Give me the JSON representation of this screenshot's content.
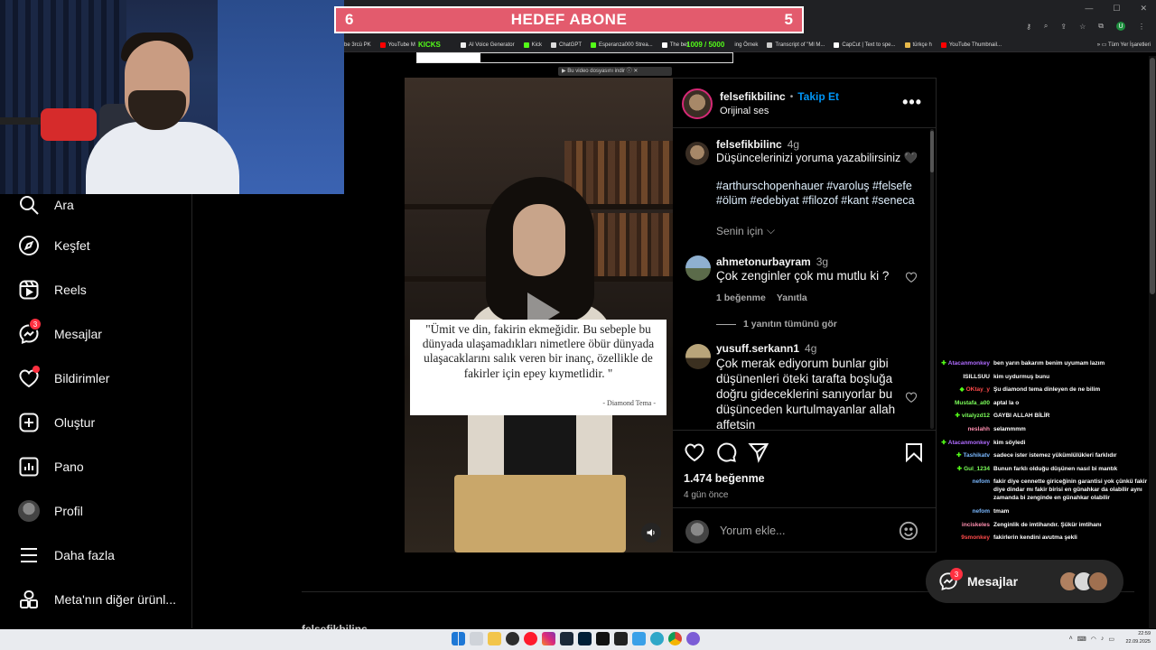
{
  "stream": {
    "goal_left": "6",
    "goal_title": "HEDEF ABONE",
    "goal_right": "5",
    "kicks_label": "KICKS",
    "kicks_count": "1009 / 5000",
    "kicks_progress": 0.2,
    "download_bar": "Bu video dosyasını indir"
  },
  "bookmarks": [
    "tube 3rcü PK",
    "YouTube M",
    "AI Voice Generator",
    "Kick",
    "ChatGPT",
    "Esperanza000 Strea...",
    "The bes",
    "ing Örnek",
    "Transcript of \"Ml M...",
    "CapCut | Text to spe...",
    "türkçe h",
    "YouTube Thumbnail..."
  ],
  "bookmarks_right": "Tüm Yer İşaretleri",
  "nav": {
    "search": "Ara",
    "explore": "Keşfet",
    "reels": "Reels",
    "messages": "Mesajlar",
    "messages_badge": "3",
    "notifications": "Bildirimler",
    "create": "Oluştur",
    "dashboard": "Pano",
    "profile": "Profil",
    "more": "Daha fazla",
    "meta": "Meta'nın diğer ürünl..."
  },
  "post": {
    "username": "felsefikbilinc",
    "dot": "•",
    "follow": "Takip Et",
    "audio": "Orijinal ses",
    "caption_time": "4g",
    "caption": "Düşüncelerinizi yoruma yazabilirsiniz 🖤",
    "hashtags_line1": "#arthurschopenhauer #varoluş #felsefe",
    "hashtags_line2": "#ölüm #edebiyat #filozof #kant #seneca",
    "translation_toggle": "Senin için",
    "quote": "\"Ümit ve din, fakirin ekmeğidir. Bu sebeple bu dünyada ulaşamadıkları nimetlere öbür dünyada ulaşacaklarını salık veren bir inanç, özellikle de fakirler için epey kıymetlidir. \"",
    "quote_source": "- Diamond Tema -",
    "likes": "1.474 beğenme",
    "date": "4 gün önce",
    "comment_placeholder": "Yorum ekle..."
  },
  "comments": [
    {
      "user": "ahmetonurbayram",
      "time": "3g",
      "text": "Çok zenginler çok mu mutlu ki ?",
      "likes": "1 beğenme",
      "reply": "Yanıtla",
      "view_replies": "1 yanıtın tümünü gör"
    },
    {
      "user": "yusuff.serkann1",
      "time": "4g",
      "text": "Çok merak ediyorum bunlar gibi düşünenleri öteki tarafta boşluğa doğru gideceklerini sanıyorlar bu düşünceden kurtulmayanlar allah affetsin"
    }
  ],
  "chat": [
    {
      "user": "Atacanmonkey",
      "msg": "ben yarın bakarım benim uyumam lazım",
      "color": "#b06bff",
      "icon": "✚"
    },
    {
      "user": "ISILLSUU",
      "msg": "kim uydurmuş bunu",
      "color": "#ffffff",
      "icon": ""
    },
    {
      "user": "OKtay_y",
      "msg": "Şu diamond tema dinleyen de ne bilim",
      "color": "#ff4a4a",
      "icon": "◆"
    },
    {
      "user": "Mustafa_a00",
      "msg": "aptal la o",
      "color": "#7cff5a",
      "icon": ""
    },
    {
      "user": "vitalyzd12",
      "msg": "GAYBI ALLAH BİLİR",
      "color": "#7cff5a",
      "icon": "✚"
    },
    {
      "user": "neslahh",
      "msg": "selammmm",
      "color": "#ff8fb0",
      "icon": ""
    },
    {
      "user": "Atacanmonkey",
      "msg": "kim söyledi",
      "color": "#b06bff",
      "icon": "✚"
    },
    {
      "user": "Tashikatv",
      "msg": "sadece ister istemez yükümlülükleri farklıdır",
      "color": "#7ab8ff",
      "icon": "✚"
    },
    {
      "user": "Gul_1234",
      "msg": "Bunun farklı olduğu düşünen nasıl bi mantık",
      "color": "#7cff5a",
      "icon": "✚"
    },
    {
      "user": "nefom",
      "msg": "fakir diye cennette giriceğinin garantisi yok çünkü fakir diye dindar mı fakir birisi en günahkar da olabilir aynı zamanda bi zenginde en günahkar olabilir",
      "color": "#7ab8ff",
      "icon": ""
    },
    {
      "user": "nefom",
      "msg": "tmam",
      "color": "#7ab8ff",
      "icon": ""
    },
    {
      "user": "inciskeles",
      "msg": "Zenginlik de imtihandır. Şükür imtihanı",
      "color": "#ff8fb0",
      "icon": ""
    },
    {
      "user": "9smonkey",
      "msg": "fakirlerin kendini avutma şekli",
      "color": "#ff4a4a",
      "icon": ""
    }
  ],
  "messages_pill": {
    "label": "Mesajlar",
    "badge": "3"
  },
  "bottom_cut": "felsefikbilinc",
  "clock": {
    "time": "22:59",
    "date": "22.09.2025"
  }
}
